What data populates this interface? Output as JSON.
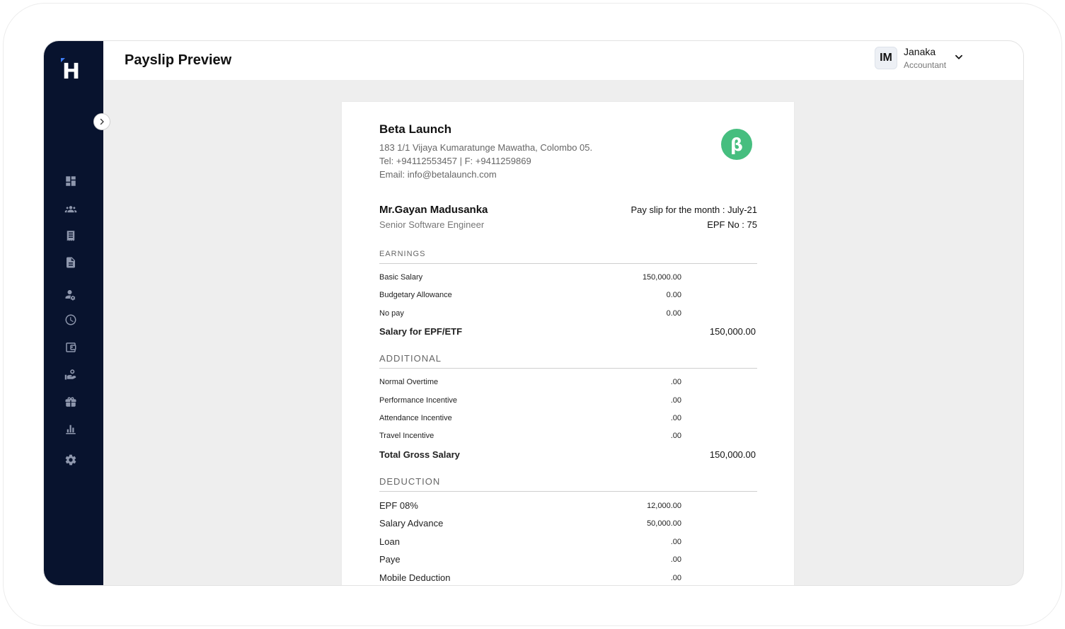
{
  "header": {
    "title": "Payslip Preview"
  },
  "user": {
    "initials": "IM",
    "name": "Janaka",
    "role": "Accountant"
  },
  "company": {
    "name": "Beta Launch",
    "address": "183 1/1 Vijaya Kumaratunge Mawatha, Colombo 05.",
    "contact": "Tel: +94112553457 | F: +9411259869",
    "email": "Email: info@betalaunch.com",
    "logo_letter": "β"
  },
  "employee": {
    "name": "Mr.Gayan Madusanka",
    "title": "Senior Software Engineer",
    "payslip_month": "Pay slip for the month : July-21",
    "epf_no": "EPF No : 75"
  },
  "earnings": {
    "title": "EARNINGS",
    "rows": [
      {
        "label": "Basic Salary",
        "amount": "150,000.00"
      },
      {
        "label": "Budgetary Allowance",
        "amount": "0.00"
      },
      {
        "label": "No pay",
        "amount": "0.00"
      }
    ],
    "total_label": "Salary for EPF/ETF",
    "total": "150,000.00"
  },
  "additional": {
    "title": "ADDITIONAL",
    "rows": [
      {
        "label": "Normal Overtime",
        "amount": ".00"
      },
      {
        "label": "Performance Incentive",
        "amount": ".00"
      },
      {
        "label": "Attendance Incentive",
        "amount": ".00"
      },
      {
        "label": "Travel Incentive",
        "amount": ".00"
      }
    ],
    "total_label": "Total Gross Salary",
    "total": "150,000.00"
  },
  "deduction": {
    "title": "DEDUCTION",
    "rows": [
      {
        "label": "EPF 08%",
        "amount": "12,000.00"
      },
      {
        "label": "Salary Advance",
        "amount": "50,000.00"
      },
      {
        "label": "Loan",
        "amount": ".00"
      },
      {
        "label": "Paye",
        "amount": ".00"
      },
      {
        "label": "Mobile Deduction",
        "amount": ".00"
      }
    ]
  },
  "nav_icons": [
    "dashboard-icon",
    "team-icon",
    "receipt-icon",
    "document-icon",
    "user-settings-icon",
    "clock-icon",
    "wallet-icon",
    "payment-hand-icon",
    "gift-icon",
    "bar-chart-icon",
    "settings-icon"
  ],
  "colors": {
    "sidebar": "#08132e",
    "logo_accent": "#3d7cf4",
    "company_logo": "#46be7f",
    "background": "#eeeeee"
  }
}
